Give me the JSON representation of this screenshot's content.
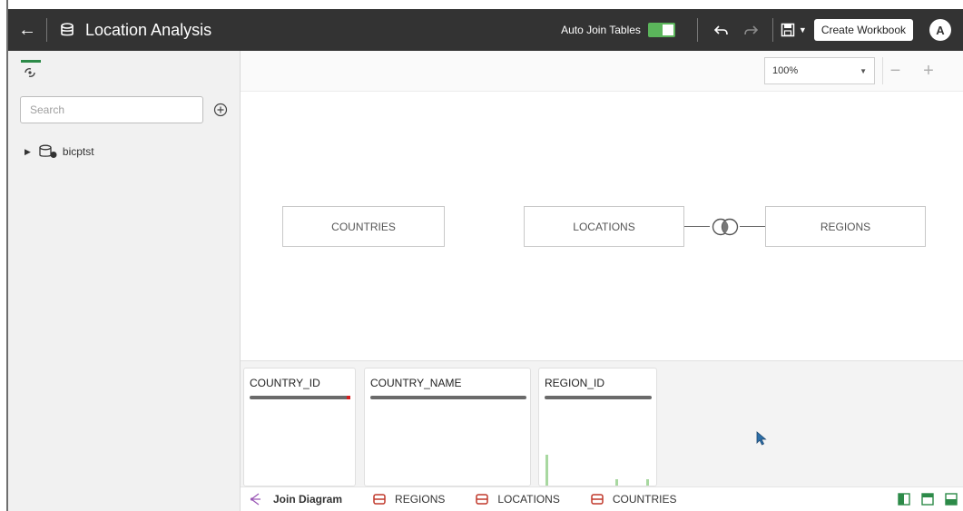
{
  "header": {
    "title": "Location Analysis",
    "auto_join_label": "Auto Join Tables",
    "auto_join_on": true,
    "create_workbook_label": "Create Workbook",
    "avatar_initial": "A"
  },
  "sidebar": {
    "search_placeholder": "Search",
    "tree": [
      {
        "label": "bicptst"
      }
    ]
  },
  "zoom": {
    "value": "100%"
  },
  "diagram": {
    "tables": [
      "COUNTRIES",
      "LOCATIONS",
      "REGIONS"
    ]
  },
  "preview": {
    "columns": [
      {
        "name": "COUNTRY_ID"
      },
      {
        "name": "COUNTRY_NAME"
      },
      {
        "name": "REGION_ID"
      }
    ]
  },
  "tabs": [
    {
      "label": "Join Diagram",
      "active": true
    },
    {
      "label": "REGIONS"
    },
    {
      "label": "LOCATIONS"
    },
    {
      "label": "COUNTRIES"
    }
  ],
  "colors": {
    "header": "#333333",
    "toggle": "#5bb55b",
    "accent_green": "#2c8a48",
    "table_icon": "#c0392b",
    "join_icon": "#9b59b6"
  }
}
